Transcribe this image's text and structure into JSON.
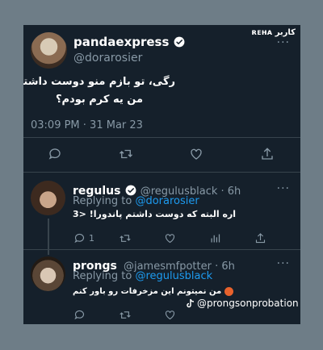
{
  "watermark": {
    "text": "ʀᴇʜᴀ كاربر"
  },
  "main_tweet": {
    "display_name": "pandaexpress",
    "handle": "@dorarosier",
    "text_line1": "رگی، تو بازم منو دوست داشتی اگه",
    "text_line2": "من یه کرم بودم؟",
    "timestamp": "03:09 PM · 31 Mar 23"
  },
  "reply1": {
    "display_name": "regulus",
    "handle": "@regulusblack · 6h",
    "replying_prefix": "Replying to",
    "replying_to": "@dorarosier",
    "text": "اره البته که دوست داشتم پاندورا! <3",
    "reply_count": "1"
  },
  "reply2": {
    "display_name": "prongs",
    "handle": "@jamesmfpotter · 6h",
    "replying_prefix": "Replying to",
    "replying_to": "@regulusblack",
    "text": "من نمیتونم این مزخرفات رو باور کنم",
    "tiktok_handle": "@prongsonprobation"
  },
  "colors": {
    "background": "#15202b",
    "accent": "#1d9bf0",
    "muted": "#8899a6",
    "page": "#6e7d87"
  }
}
